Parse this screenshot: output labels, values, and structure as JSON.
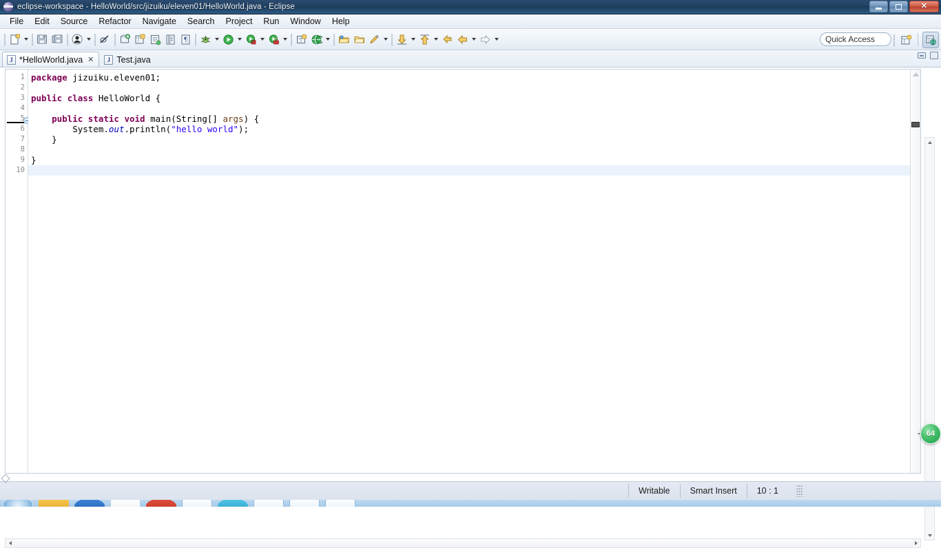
{
  "window": {
    "title": "eclipse-workspace - HelloWorld/src/jizuiku/eleven01/HelloWorld.java - Eclipse",
    "logo_icon": "eclipse-logo-icon",
    "minimize_label": "minimize-icon",
    "maximize_label": "restore-icon",
    "close_label": "✕"
  },
  "menubar": {
    "items": [
      {
        "label": "File"
      },
      {
        "label": "Edit"
      },
      {
        "label": "Source"
      },
      {
        "label": "Refactor"
      },
      {
        "label": "Navigate"
      },
      {
        "label": "Search"
      },
      {
        "label": "Project"
      },
      {
        "label": "Run"
      },
      {
        "label": "Window"
      },
      {
        "label": "Help"
      }
    ]
  },
  "toolbar": {
    "quick_access_placeholder": "Quick Access",
    "items": [
      {
        "name": "new-wizard-icon",
        "kind": "icon"
      },
      {
        "name": "new-wizard-dropdown",
        "kind": "arrow"
      },
      {
        "name": "separator-1",
        "kind": "sep"
      },
      {
        "name": "save-icon",
        "kind": "icon"
      },
      {
        "name": "save-all-icon",
        "kind": "icon"
      },
      {
        "name": "separator-2",
        "kind": "sep"
      },
      {
        "name": "person-icon",
        "kind": "icon"
      },
      {
        "name": "person-dropdown",
        "kind": "arrow"
      },
      {
        "name": "separator-3",
        "kind": "sep"
      },
      {
        "name": "skip-breakpoints-icon",
        "kind": "icon"
      },
      {
        "name": "separator-4",
        "kind": "sep"
      },
      {
        "name": "new-java-project-icon",
        "kind": "icon"
      },
      {
        "name": "new-java-package-icon",
        "kind": "icon"
      },
      {
        "name": "new-java-class-icon",
        "kind": "icon"
      },
      {
        "name": "open-type-icon",
        "kind": "icon"
      },
      {
        "name": "open-task-icon",
        "kind": "icon"
      },
      {
        "name": "toggle-mark-occurrences-icon",
        "kind": "icon"
      },
      {
        "name": "separator-5",
        "kind": "sep"
      },
      {
        "name": "debug-icon",
        "kind": "icon"
      },
      {
        "name": "debug-dropdown",
        "kind": "arrow"
      },
      {
        "name": "run-icon",
        "kind": "icon"
      },
      {
        "name": "run-dropdown",
        "kind": "arrow"
      },
      {
        "name": "run-external-tools-icon",
        "kind": "icon"
      },
      {
        "name": "run-external-dropdown",
        "kind": "arrow"
      },
      {
        "name": "coverage-icon",
        "kind": "icon"
      },
      {
        "name": "coverage-dropdown",
        "kind": "arrow"
      },
      {
        "name": "separator-6",
        "kind": "sep"
      },
      {
        "name": "new-package-icon",
        "kind": "icon"
      },
      {
        "name": "search-globe-icon",
        "kind": "icon"
      },
      {
        "name": "search-dropdown",
        "kind": "arrow"
      },
      {
        "name": "separator-7",
        "kind": "sep"
      },
      {
        "name": "open-folder-icon",
        "kind": "icon"
      },
      {
        "name": "open-folder-2-icon",
        "kind": "icon"
      },
      {
        "name": "pencil-edit-icon",
        "kind": "icon"
      },
      {
        "name": "pencil-dropdown",
        "kind": "arrow"
      },
      {
        "name": "separator-8",
        "kind": "sep"
      },
      {
        "name": "next-annotation-icon",
        "kind": "icon"
      },
      {
        "name": "next-annotation-dropdown",
        "kind": "arrow"
      },
      {
        "name": "previous-annotation-icon",
        "kind": "icon"
      },
      {
        "name": "previous-annotation-dropdown",
        "kind": "arrow"
      },
      {
        "name": "last-edit-location-icon",
        "kind": "icon"
      },
      {
        "name": "back-icon",
        "kind": "icon"
      },
      {
        "name": "back-dropdown",
        "kind": "arrow"
      },
      {
        "name": "forward-icon",
        "kind": "icon"
      },
      {
        "name": "forward-dropdown",
        "kind": "arrow"
      }
    ],
    "perspective_open_icon": "open-perspective-icon",
    "perspective_java_icon": "java-perspective-icon"
  },
  "tabs": [
    {
      "label": "*HelloWorld.java",
      "icon": "java-file-icon",
      "active": true,
      "close": "✕"
    },
    {
      "label": "Test.java",
      "icon": "java-file-icon",
      "active": false,
      "close": ""
    }
  ],
  "editor": {
    "minimize_icon": "minimize-view-icon",
    "maximize_icon": "maximize-view-icon",
    "line_numbers": [
      "1",
      "2",
      "3",
      "4",
      "5",
      "6",
      "7",
      "8",
      "9",
      "10"
    ],
    "current_line": 10,
    "folding_line": 5,
    "lines": [
      {
        "n": 1,
        "tokens": [
          {
            "t": "package",
            "c": "kw"
          },
          {
            "t": " jizuiku.eleven01;",
            "c": "pl"
          }
        ]
      },
      {
        "n": 2,
        "tokens": [
          {
            "t": "",
            "c": "pl"
          }
        ]
      },
      {
        "n": 3,
        "tokens": [
          {
            "t": "public",
            "c": "kw"
          },
          {
            "t": " ",
            "c": "pl"
          },
          {
            "t": "class",
            "c": "kw"
          },
          {
            "t": " HelloWorld {",
            "c": "pl"
          }
        ]
      },
      {
        "n": 4,
        "tokens": [
          {
            "t": "",
            "c": "pl"
          }
        ]
      },
      {
        "n": 5,
        "tokens": [
          {
            "t": "    ",
            "c": "pl"
          },
          {
            "t": "public",
            "c": "kw"
          },
          {
            "t": " ",
            "c": "pl"
          },
          {
            "t": "static",
            "c": "kw"
          },
          {
            "t": " ",
            "c": "pl"
          },
          {
            "t": "void",
            "c": "kw"
          },
          {
            "t": " main(String[] ",
            "c": "pl"
          },
          {
            "t": "args",
            "c": "par"
          },
          {
            "t": ") {",
            "c": "pl"
          }
        ]
      },
      {
        "n": 6,
        "tokens": [
          {
            "t": "        System.",
            "c": "pl"
          },
          {
            "t": "out",
            "c": "fld"
          },
          {
            "t": ".println(",
            "c": "pl"
          },
          {
            "t": "\"hello world\"",
            "c": "str"
          },
          {
            "t": ");",
            "c": "pl"
          }
        ]
      },
      {
        "n": 7,
        "tokens": [
          {
            "t": "    }",
            "c": "pl"
          }
        ]
      },
      {
        "n": 8,
        "tokens": [
          {
            "t": "",
            "c": "pl"
          }
        ]
      },
      {
        "n": 9,
        "tokens": [
          {
            "t": "}",
            "c": "pl"
          }
        ]
      },
      {
        "n": 10,
        "tokens": [
          {
            "t": "",
            "c": "pl"
          }
        ]
      }
    ]
  },
  "statusbar": {
    "writable": "Writable",
    "insert_mode": "Smart Insert",
    "cursor_position": "10 : 1"
  },
  "overlay": {
    "badge": "64"
  },
  "colors": {
    "keyword": "#7f0055",
    "string": "#2a00ff",
    "field": "#0000c0",
    "parameter": "#6a3e14",
    "current_line": "#eaf2fc",
    "titlebar": "#1b3b5c",
    "statusbar": "#dde3ee"
  }
}
